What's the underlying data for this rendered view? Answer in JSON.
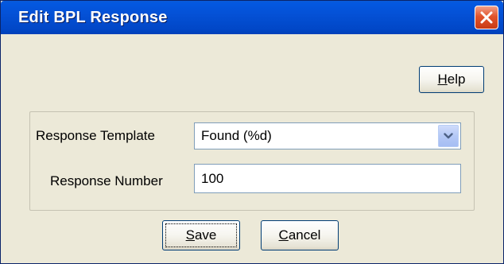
{
  "window": {
    "title": "Edit BPL Response",
    "close_icon": "close-icon"
  },
  "toolbar": {
    "help_prefix": "",
    "help_mnemonic": "H",
    "help_rest": "elp"
  },
  "form": {
    "response_template": {
      "label": "Response Template",
      "value": "Found (%d)",
      "arrow_icon": "chevron-down-icon"
    },
    "response_number": {
      "label": "Response Number",
      "value": "100"
    }
  },
  "footer": {
    "save_mnemonic": "S",
    "save_rest": "ave",
    "cancel_mnemonic": "C",
    "cancel_rest": "ancel"
  },
  "colors": {
    "title_bar": "#0451d6",
    "close_button": "#e2542c",
    "dialog_background": "#ece9d8",
    "field_border": "#7f9db9"
  }
}
